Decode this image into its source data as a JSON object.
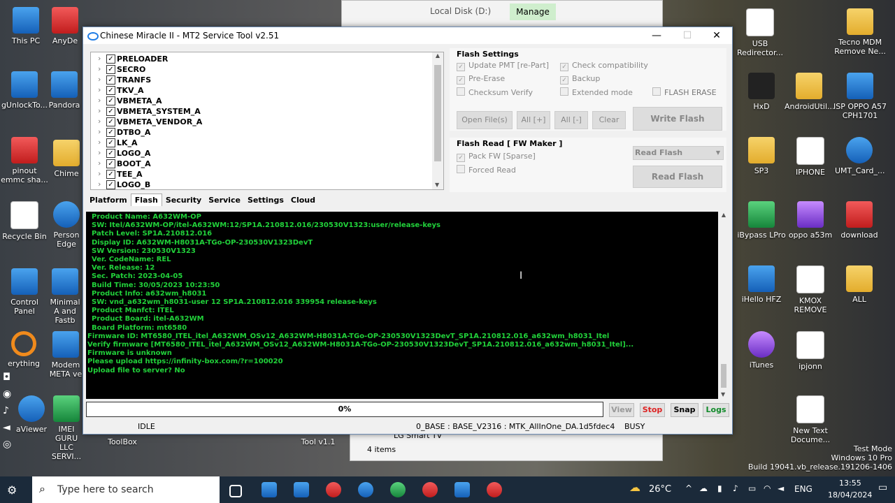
{
  "explorer": {
    "title": "Local Disk (D:)",
    "manage": "Manage",
    "item": "LG Smart TV",
    "count": "4 items"
  },
  "desktop": {
    "left": [
      "This PC",
      "AnyDe",
      "gUnlockTo...",
      "Pandora",
      "pinout emmc sha...",
      "Chime",
      "Recycle Bin",
      "Person Edge",
      "Control Panel",
      "Minimal A and Fastb",
      "erything",
      "Modem META ve",
      "aViewer",
      "IMEI GURU LLC SERVI...",
      "ToolBox",
      "Tool v1.1"
    ],
    "right": [
      "USB Redirector...",
      "Tecno MDM Remove Ne...",
      "HxD",
      "AndroidUtil...",
      "ISP OPPO A57 CPH1701",
      "SP3",
      "IPHONE",
      "UMT_Card_...",
      "iBypass LPro",
      "oppo a53m",
      "download",
      "iHello HFZ",
      "KMOX REMOVE",
      "ALL",
      "iTunes",
      "ipjonn",
      "New Text Docume..."
    ]
  },
  "window": {
    "title": "Chinese Miracle II - MT2 Service Tool v2.51",
    "partitions": [
      "PRELOADER",
      "SECRO",
      "TRANFS",
      "TKV_A",
      "VBMETA_A",
      "VBMETA_SYSTEM_A",
      "VBMETA_VENDOR_A",
      "DTBO_A",
      "LK_A",
      "LOGO_A",
      "BOOT_A",
      "TEE_A",
      "LOGO_B"
    ],
    "flash_settings": {
      "title": "Flash Settings",
      "update_pmt": "Update PMT [re-Part]",
      "check_compat": "Check compatibility",
      "pre_erase": "Pre-Erase",
      "backup": "Backup",
      "checksum": "Checksum Verify",
      "extended": "Extended mode",
      "flash_erase": "FLASH ERASE",
      "open_files": "Open File(s)",
      "all_plus": "All [+]",
      "all_minus": "All [-]",
      "clear": "Clear",
      "write_flash": "Write Flash"
    },
    "flash_read": {
      "title": "Flash Read [ FW Maker ]",
      "pack_fw": "Pack FW [Sparse]",
      "forced_read": "Forced Read",
      "read_select": "Read Flash",
      "read_button": "Read Flash"
    },
    "tabs": [
      "Platform",
      "Flash",
      "Security",
      "Service",
      "Settings",
      "Cloud"
    ],
    "log": [
      "Product Name: A632WM-OP",
      "SW: Itel/A632WM-OP/itel-A632WM:12/SP1A.210812.016/230530V1323:user/release-keys",
      "Patch Level: SP1A.210812.016",
      "Display ID: A632WM-H8031A-TGo-OP-230530V1323DevT",
      "SW Version: 230530V1323",
      "Ver. CodeName: REL",
      "Ver. Release: 12",
      "Sec. Patch: 2023-04-05",
      "Build Time: 30/05/2023 10:23:50",
      "Product Info: a632wm_h8031",
      "SW: vnd_a632wm_h8031-user 12 SP1A.210812.016 339954 release-keys",
      "Product Manfct: ITEL",
      "Product Board: itel-A632WM",
      "Board Platform: mt6580",
      "Firmware ID: MT6580_ITEL_itel_A632WM_OSv12_A632WM-H8031A-TGo-OP-230530V1323DevT_SP1A.210812.016_a632wm_h8031_Itel",
      "Verify firmware [MT6580_ITEL_itel_A632WM_OSv12_A632WM-H8031A-TGo-OP-230530V1323DevT_SP1A.210812.016_a632wm_h8031_Itel]...",
      "Firmware is unknown",
      "Please upload https://infinity-box.com/?r=100020",
      "Upload file to server? No"
    ],
    "progress": "0%",
    "buttons": {
      "view": "View",
      "stop": "Stop",
      "snap": "Snap",
      "logs": "Logs"
    },
    "status": {
      "left": "IDLE",
      "mid": "0_BASE : BASE_V2316 : MTK_AllInOne_DA.1d5fdec4",
      "right": "BUSY"
    }
  },
  "watermark": {
    "line1": "Test Mode",
    "line2": "Windows 10 Pro",
    "line3": "Build 19041.vb_release.191206-1406"
  },
  "taskbar": {
    "search": "Type here to search",
    "weather": "26°C",
    "lang": "ENG",
    "time": "13:55",
    "date": "18/04/2024"
  }
}
